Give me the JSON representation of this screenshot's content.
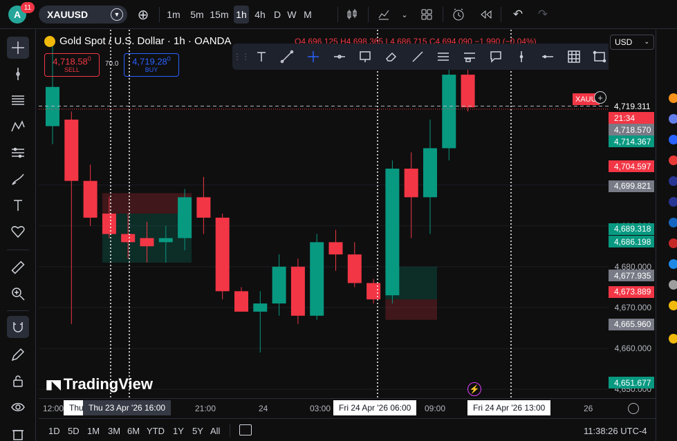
{
  "user": {
    "initial": "A",
    "notifications": "11"
  },
  "symbol": {
    "ticker": "XAUUSD"
  },
  "timeframes": [
    "1m",
    "5m",
    "15m",
    "1h",
    "4h",
    "D",
    "W",
    "M"
  ],
  "active_timeframe": "1h",
  "legend": {
    "title": "Gold Spot / U.S. Dollar · 1h · OANDA",
    "ohlc": "O4,696.125 H4,698.365 L4,686.715 C4,694.090 −1.990 (−0.04%)"
  },
  "trade": {
    "sell_price": "4,718.58",
    "sell_sup": "0",
    "sell_label": "SELL",
    "spread": "70.0",
    "buy_price": "4,719.28",
    "buy_sup": "0",
    "buy_label": "BUY"
  },
  "currency": "USD",
  "price_ticks": [
    "4,700.000",
    "4,690.000",
    "4,680.000",
    "4,670.000",
    "4,660.000",
    "4,650.000"
  ],
  "price_labels": [
    {
      "text": "4,719.311",
      "bg": "#0f0f0f",
      "color": "#ffffff"
    },
    {
      "text": "21:34",
      "bg": "#f23645",
      "color": "#ffffff"
    },
    {
      "text": "4,718.570",
      "bg": "#787b86",
      "color": "#ffffff"
    },
    {
      "text": "4,714.367",
      "bg": "#089981",
      "color": "#ffffff"
    },
    {
      "text": "4,704.597",
      "bg": "#f23645",
      "color": "#ffffff"
    },
    {
      "text": "4,699.821",
      "bg": "#787b86",
      "color": "#ffffff"
    },
    {
      "text": "4,689.318",
      "bg": "#089981",
      "color": "#ffffff"
    },
    {
      "text": "4,686.198",
      "bg": "#089981",
      "color": "#ffffff"
    },
    {
      "text": "4,677.935",
      "bg": "#787b86",
      "color": "#ffffff"
    },
    {
      "text": "4,673.889",
      "bg": "#f23645",
      "color": "#ffffff"
    },
    {
      "text": "4,665.960",
      "bg": "#787b86",
      "color": "#ffffff"
    },
    {
      "text": "4,651.677",
      "bg": "#089981",
      "color": "#ffffff"
    }
  ],
  "symbol_tag": "XAUU",
  "time_ticks": [
    "12:00",
    "21:00",
    "24",
    "03:00",
    "09:00",
    "26"
  ],
  "time_labels": [
    "Thu 23 Apr '26   16:00",
    "Fri 24 Apr '26   06:00",
    "Fri 24 Apr '26   13:00"
  ],
  "time_label_partial": "Thu",
  "ranges": [
    "1D",
    "5D",
    "1M",
    "3M",
    "6M",
    "YTD",
    "1Y",
    "5Y",
    "All"
  ],
  "clock": "11:38:26 UTC-4",
  "watermark": "TradingView",
  "colors": {
    "up": "#089981",
    "down": "#f23645",
    "accent": "#2962ff"
  },
  "chart_data": {
    "type": "candlestick",
    "candles": [
      {
        "o": 4714.4,
        "h": 4735,
        "l": 4710,
        "c": 4724
      },
      {
        "o": 4716,
        "h": 4718,
        "l": 4666,
        "c": 4701
      },
      {
        "o": 4701,
        "h": 4705,
        "l": 4690,
        "c": 4692
      },
      {
        "o": 4693,
        "h": 4697,
        "l": 4687,
        "c": 4688
      },
      {
        "o": 4688,
        "h": 4693,
        "l": 4682,
        "c": 4686
      },
      {
        "o": 4687,
        "h": 4691,
        "l": 4681,
        "c": 4685
      },
      {
        "o": 4686,
        "h": 4690,
        "l": 4681,
        "c": 4687
      },
      {
        "o": 4687,
        "h": 4699,
        "l": 4684,
        "c": 4697
      },
      {
        "o": 4697,
        "h": 4702,
        "l": 4688,
        "c": 4692
      },
      {
        "o": 4692,
        "h": 4693,
        "l": 4672,
        "c": 4674
      },
      {
        "o": 4674,
        "h": 4675,
        "l": 4669,
        "c": 4669
      },
      {
        "o": 4669,
        "h": 4674,
        "l": 4659,
        "c": 4671
      },
      {
        "o": 4671,
        "h": 4683,
        "l": 4668,
        "c": 4680
      },
      {
        "o": 4680,
        "h": 4682,
        "l": 4666,
        "c": 4668
      },
      {
        "o": 4668,
        "h": 4688,
        "l": 4667,
        "c": 4686
      },
      {
        "o": 4686,
        "h": 4689,
        "l": 4679,
        "c": 4683
      },
      {
        "o": 4683,
        "h": 4686,
        "l": 4675,
        "c": 4676
      },
      {
        "o": 4676,
        "h": 4677,
        "l": 4671,
        "c": 4672
      },
      {
        "o": 4673,
        "h": 4706,
        "l": 4671,
        "c": 4704
      },
      {
        "o": 4704,
        "h": 4708,
        "l": 4687,
        "c": 4697
      },
      {
        "o": 4697,
        "h": 4716,
        "l": 4688,
        "c": 4709
      },
      {
        "o": 4709,
        "h": 4732,
        "l": 4706,
        "c": 4727
      },
      {
        "o": 4727,
        "h": 4730,
        "l": 4718,
        "c": 4719
      }
    ],
    "ylim": [
      4648,
      4738
    ],
    "xlabel": "",
    "ylabel": ""
  }
}
